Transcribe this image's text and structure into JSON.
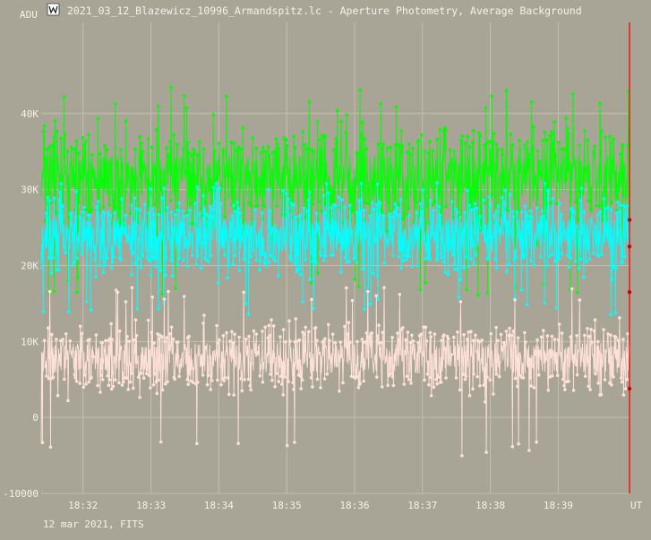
{
  "window": {
    "title": "2021_03_12_Blazewicz_10996_Armandspitz.lc - Aperture Photometry, Average Background",
    "app_icon": "muniwin-icon"
  },
  "chart_data": {
    "type": "line",
    "ylabel": "ADU",
    "xlabel": "UT",
    "footer": "12 mar 2021, FITS",
    "ylim": [
      -10000,
      52000
    ],
    "xlim": [
      "18:31:23",
      "18:40:03"
    ],
    "yticks": [
      {
        "value": 40000,
        "label": "40K"
      },
      {
        "value": 30000,
        "label": "30K"
      },
      {
        "value": 20000,
        "label": "20K"
      },
      {
        "value": 10000,
        "label": "10K"
      },
      {
        "value": 0,
        "label": "0"
      },
      {
        "value": -10000,
        "label": "-10000"
      }
    ],
    "xticks": [
      {
        "time": "18:32",
        "label": "18:32"
      },
      {
        "time": "18:33",
        "label": "18:33"
      },
      {
        "time": "18:34",
        "label": "18:34"
      },
      {
        "time": "18:35",
        "label": "18:35"
      },
      {
        "time": "18:36",
        "label": "18:36"
      },
      {
        "time": "18:37",
        "label": "18:37"
      },
      {
        "time": "18:38",
        "label": "18:38"
      },
      {
        "time": "18:39",
        "label": "18:39"
      }
    ],
    "grid": true,
    "cursor_time": "18:40:03",
    "sample_interval_s": 0.36,
    "series": [
      {
        "color": "#00ff00",
        "mean": 31500,
        "spread": 3000,
        "min": 16000,
        "max": 43500
      },
      {
        "color": "#00ffff",
        "mean": 24000,
        "spread": 2300,
        "min": 13500,
        "max": 31000
      },
      {
        "color": "#ffe0d8",
        "mean": 7800,
        "spread": 2000,
        "min": -5200,
        "max": 17200
      }
    ],
    "cursor_markers": [
      26000,
      22500,
      16500,
      3800
    ]
  },
  "colors": {
    "background": "#a8a596",
    "grid": "#c2bfb2",
    "axis_text": "#f4f2ea",
    "cursor": "#ff0000"
  }
}
